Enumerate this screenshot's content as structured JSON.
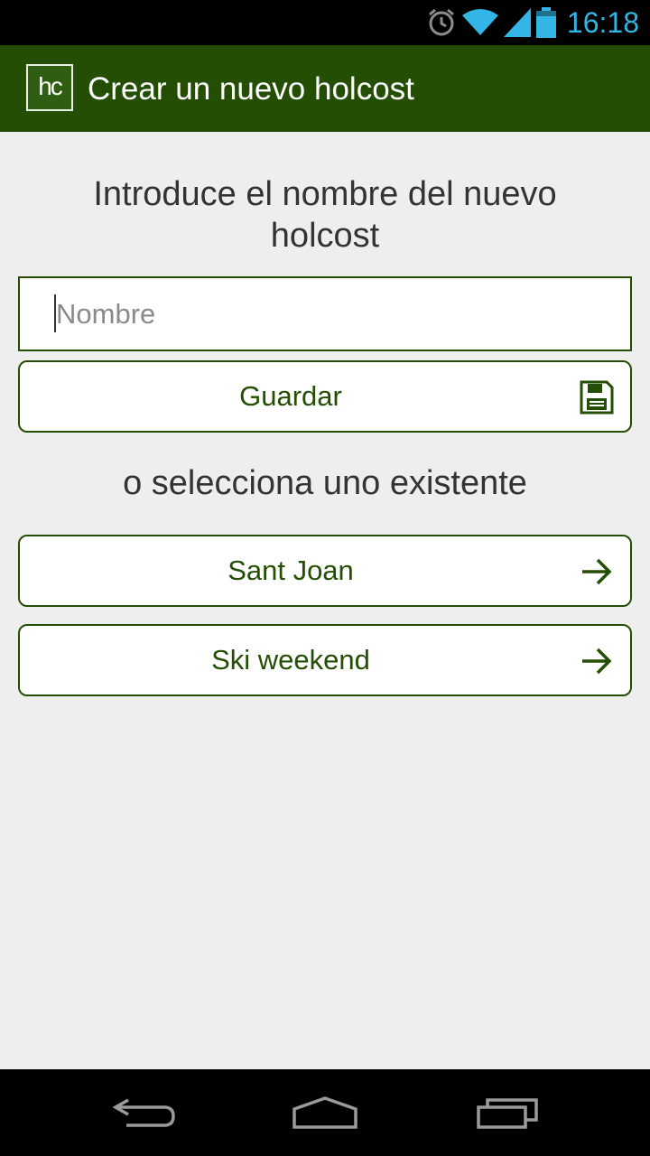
{
  "status_bar": {
    "time": "16:18"
  },
  "action_bar": {
    "logo_text": "hc",
    "title": "Crear un nuevo holcost"
  },
  "form": {
    "prompt": "Introduce el nombre del nuevo holcost",
    "name_input": {
      "placeholder": "Nombre",
      "value": ""
    },
    "save_label": "Guardar"
  },
  "existing": {
    "heading": "o selecciona uno existente",
    "items": [
      {
        "label": "Sant Joan"
      },
      {
        "label": "Ski weekend"
      }
    ]
  },
  "colors": {
    "primary": "#234e04",
    "accent": "#33b5e5",
    "background": "#eeeeee"
  },
  "icons": {
    "status": [
      "alarm-icon",
      "wifi-icon",
      "signal-icon",
      "battery-icon"
    ],
    "save": "floppy-disk-icon",
    "item": "arrow-right-icon",
    "nav": [
      "back-icon",
      "home-icon",
      "recent-apps-icon"
    ]
  }
}
